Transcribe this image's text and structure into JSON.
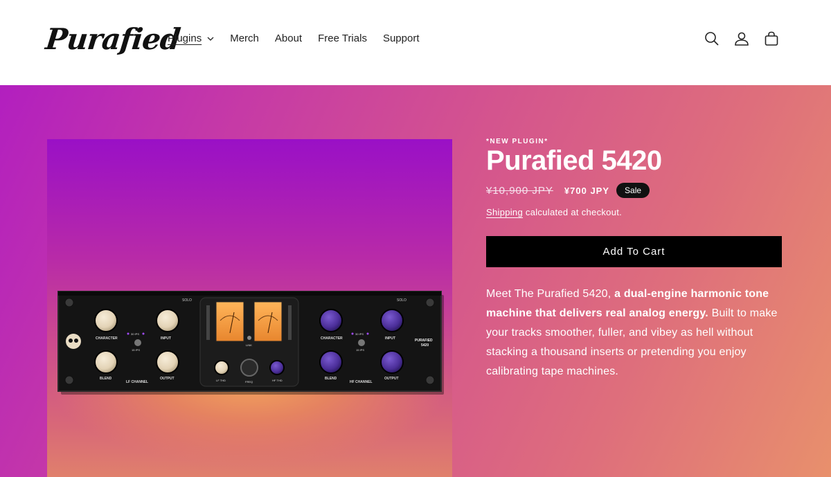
{
  "brand": {
    "logo_text": "Purafied"
  },
  "nav": [
    {
      "label": "Plugins",
      "has_dropdown": true,
      "active": true
    },
    {
      "label": "Merch"
    },
    {
      "label": "About"
    },
    {
      "label": "Free Trials"
    },
    {
      "label": "Support"
    }
  ],
  "header_icons": [
    "search-icon",
    "account-icon",
    "cart-icon"
  ],
  "product": {
    "tag": "*NEW PLUGIN*",
    "title": "Purafied 5420",
    "old_price": "¥10,900 JPY",
    "new_price": "¥700 JPY",
    "sale_label": "Sale",
    "shipping_link": "Shipping",
    "shipping_text": " calculated at checkout.",
    "add_to_cart": "Add To Cart",
    "desc_intro": "Meet The Purafied 5420, ",
    "desc_bold": "a dual-engine harmonic tone machine that delivers real analog energy.",
    "desc_rest": " Built to make your tracks smoother, fuller, and vibey as hell without stacking a thousand inserts or pretending you enjoy calibrating tape machines."
  },
  "plugin_ui": {
    "lf": {
      "knob1": "CHARACTER",
      "knob2": "INPUT",
      "knob3": "BLEND",
      "knob4": "OUTPUT",
      "channel": "LF CHANNEL",
      "ips_top": "30 IPS",
      "ips_bottom": "15 IPS",
      "solo": "SOLO"
    },
    "hf": {
      "knob1": "CHARACTER",
      "knob2": "INPUT",
      "knob3": "BLEND",
      "knob4": "OUTPUT",
      "channel": "HF CHANNEL",
      "ips_top": "30 IPS",
      "ips_bottom": "15 IPS",
      "solo": "SOLO"
    },
    "center": {
      "k1": "LF THD",
      "k2": "FREQ",
      "k3": "HF THD",
      "link": "LINK"
    },
    "badge": "PURAFIED\n5420",
    "badge_l1": "PURAFIED",
    "badge_l2": "5420"
  },
  "colors": {
    "hero_start": "#b21fbf",
    "hero_end": "#e8906c",
    "cart_button": "#000000",
    "knob_cream": "#e9dcc4",
    "knob_purple": "#5b3aa8",
    "meter_orange": "#f19a3e"
  }
}
